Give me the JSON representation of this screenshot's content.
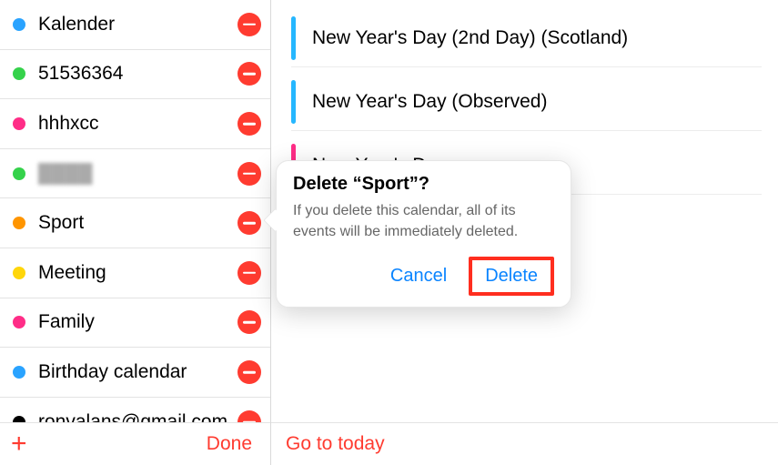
{
  "colors": {
    "danger": "#ff3b30",
    "link": "#0a84ff",
    "highlight_box": "#ff2e1f"
  },
  "sidebar": {
    "calendars": [
      {
        "name": "Kalender",
        "color": "#2aa3ff",
        "faded": false
      },
      {
        "name": "51536364",
        "color": "#35d24b",
        "faded": false
      },
      {
        "name": "hhhxcc",
        "color": "#ff2d87",
        "faded": false
      },
      {
        "name": "████",
        "color": "#35d24b",
        "faded": true
      },
      {
        "name": "Sport",
        "color": "#ff9500",
        "faded": false
      },
      {
        "name": "Meeting",
        "color": "#ffd60a",
        "faded": false
      },
      {
        "name": "Family",
        "color": "#ff2d87",
        "faded": false
      },
      {
        "name": "Birthday calendar",
        "color": "#2aa3ff",
        "faded": false
      },
      {
        "name": "ronvalans@gmail.com",
        "color": "#000000",
        "faded": false
      }
    ],
    "add_label": "+",
    "done_label": "Done"
  },
  "events": [
    {
      "title": "New Year's Day (2nd Day) (Scotland)",
      "color": "#26b7ff"
    },
    {
      "title": "New Year's Day (Observed)",
      "color": "#26b7ff"
    },
    {
      "title": "New Year's Day",
      "color": "#ff2d87"
    }
  ],
  "go_to_today_label": "Go to today",
  "dialog": {
    "title": "Delete “Sport”?",
    "message": "If you delete this calendar, all of its events will be immediately deleted.",
    "cancel_label": "Cancel",
    "delete_label": "Delete"
  }
}
